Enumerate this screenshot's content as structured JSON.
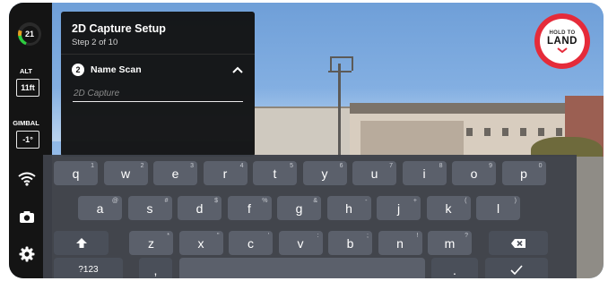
{
  "left_rail": {
    "battery_level": "21",
    "alt_label": "ALT",
    "alt_value": "11ft",
    "gimbal_label": "GIMBAL",
    "gimbal_value": "-1°",
    "icons": [
      "wifi-signal-icon",
      "camera-icon",
      "settings-gear-icon"
    ]
  },
  "panel": {
    "title": "2D Capture Setup",
    "subtitle": "Step 2 of 10",
    "section_step": "2",
    "section_label": "Name Scan",
    "input_placeholder": "2D Capture",
    "input_value": ""
  },
  "land_button": {
    "top_text": "HOLD TO",
    "label": "LAND",
    "accent": "#e52b3a"
  },
  "keyboard": {
    "row1": [
      {
        "k": "q",
        "h": "1"
      },
      {
        "k": "w",
        "h": "2"
      },
      {
        "k": "e",
        "h": "3"
      },
      {
        "k": "r",
        "h": "4"
      },
      {
        "k": "t",
        "h": "5"
      },
      {
        "k": "y",
        "h": "6"
      },
      {
        "k": "u",
        "h": "7"
      },
      {
        "k": "i",
        "h": "8"
      },
      {
        "k": "o",
        "h": "9"
      },
      {
        "k": "p",
        "h": "0"
      }
    ],
    "row2": [
      {
        "k": "a",
        "h": "@"
      },
      {
        "k": "s",
        "h": "#"
      },
      {
        "k": "d",
        "h": "$"
      },
      {
        "k": "f",
        "h": "%"
      },
      {
        "k": "g",
        "h": "&"
      },
      {
        "k": "h",
        "h": "-"
      },
      {
        "k": "j",
        "h": "+"
      },
      {
        "k": "k",
        "h": "("
      },
      {
        "k": "l",
        "h": ")"
      }
    ],
    "row3": [
      {
        "k": "z",
        "h": "*"
      },
      {
        "k": "x",
        "h": "\""
      },
      {
        "k": "c",
        "h": "'"
      },
      {
        "k": "v",
        "h": ":"
      },
      {
        "k": "b",
        "h": ";"
      },
      {
        "k": "n",
        "h": "!"
      },
      {
        "k": "m",
        "h": "?"
      }
    ],
    "symbols_key": "?123",
    "comma_key": ",",
    "period_key": ".",
    "done_icon": "checkmark-icon",
    "shift_icon": "shift-arrow-icon",
    "backspace_icon": "backspace-icon"
  }
}
